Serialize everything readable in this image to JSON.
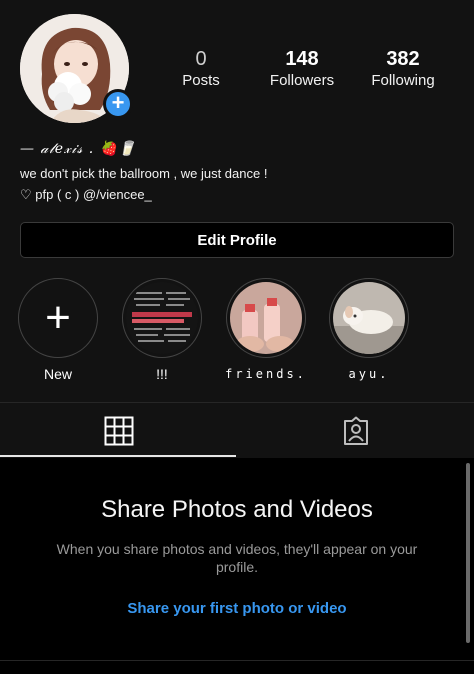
{
  "profile": {
    "stats": [
      {
        "value": "0",
        "label": "Posts"
      },
      {
        "value": "148",
        "label": "Followers"
      },
      {
        "value": "382",
        "label": "Following"
      }
    ],
    "bio_name": "— 𝒶𝓁𝑒𝓍𝒾𝓈 . 🍓🥛",
    "bio_line1": "we don't pick the ballroom , we just dance !",
    "bio_line2": "♡ pfp ( c ) @/viencee_",
    "edit_button": "Edit Profile",
    "accent": "#3897f0"
  },
  "highlights": [
    {
      "label": "New",
      "icon": "plus-icon"
    },
    {
      "label": "!!!",
      "icon": "text-collage"
    },
    {
      "label": "friends.",
      "icon": "bottles-photo"
    },
    {
      "label": "ayu.",
      "icon": "dog-photo"
    }
  ],
  "tabs": [
    {
      "name": "grid",
      "icon": "grid-icon",
      "active": true
    },
    {
      "name": "tagged",
      "icon": "tagged-person-icon",
      "active": false
    }
  ],
  "empty_state": {
    "title": "Share Photos and Videos",
    "subtitle": "When you share photos and videos, they'll appear on your profile.",
    "cta": "Share your first photo or video"
  }
}
